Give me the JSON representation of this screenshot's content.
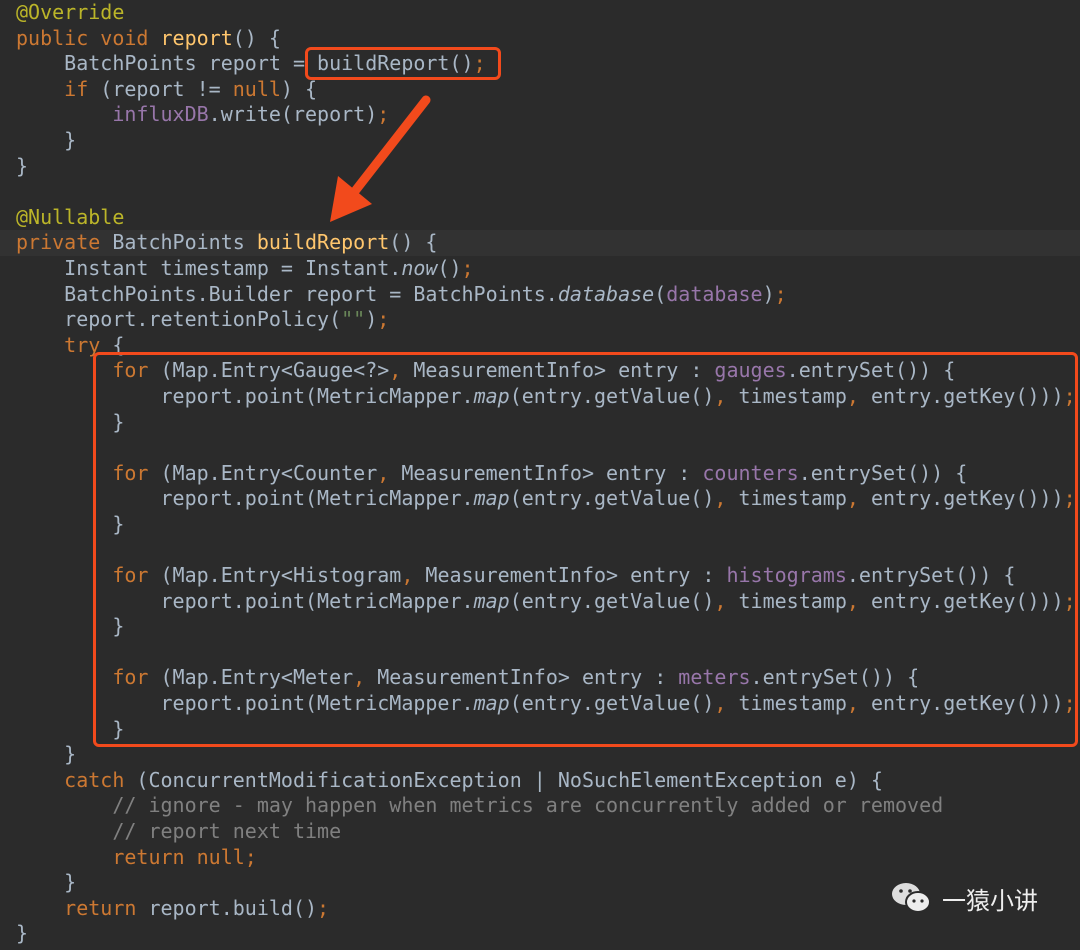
{
  "code_lines": [
    [
      [
        "@Override",
        "ann"
      ]
    ],
    [
      [
        "public void ",
        "kw"
      ],
      [
        "report",
        "decl"
      ],
      [
        "() {",
        ""
      ]
    ],
    [
      [
        "    BatchPoints report = buildReport()",
        ""
      ],
      [
        ";",
        "kw"
      ]
    ],
    [
      [
        "    if ",
        "kw"
      ],
      [
        "(report != ",
        ""
      ],
      [
        "null",
        "kw"
      ],
      [
        ") {",
        ""
      ]
    ],
    [
      [
        "        ",
        ""
      ],
      [
        "influxDB",
        "field"
      ],
      [
        ".write(report)",
        ""
      ],
      [
        ";",
        "kw"
      ]
    ],
    [
      [
        "    }",
        ""
      ]
    ],
    [
      [
        "}",
        ""
      ]
    ],
    [
      [
        "",
        ""
      ]
    ],
    [
      [
        "@Nullable",
        "ann"
      ]
    ],
    [
      [
        "private ",
        "kw"
      ],
      [
        "BatchPoints ",
        ""
      ],
      [
        "buildReport",
        "decl"
      ],
      [
        "() {",
        ""
      ]
    ],
    [
      [
        "    Instant timestamp = Instant.",
        ""
      ],
      [
        "now",
        "it"
      ],
      [
        "()",
        ""
      ],
      [
        ";",
        "kw"
      ]
    ],
    [
      [
        "    BatchPoints.Builder report = BatchPoints.",
        ""
      ],
      [
        "database",
        "it"
      ],
      [
        "(",
        ""
      ],
      [
        "database",
        "field"
      ],
      [
        ")",
        ""
      ],
      [
        ";",
        "kw"
      ]
    ],
    [
      [
        "    report.retentionPolicy(",
        ""
      ],
      [
        "\"\"",
        "str"
      ],
      [
        ")",
        ""
      ],
      [
        ";",
        "kw"
      ]
    ],
    [
      [
        "    try ",
        "kw"
      ],
      [
        "{",
        ""
      ]
    ],
    [
      [
        "        for ",
        "kw"
      ],
      [
        "(Map.Entry<Gauge<?>",
        ""
      ],
      [
        ", ",
        "kw"
      ],
      [
        "MeasurementInfo> entry : ",
        ""
      ],
      [
        "gauges",
        "field"
      ],
      [
        ".entrySet()) {",
        ""
      ]
    ],
    [
      [
        "            report.point(MetricMapper.",
        ""
      ],
      [
        "map",
        "it"
      ],
      [
        "(entry.getValue()",
        ""
      ],
      [
        ", ",
        "kw"
      ],
      [
        "timestamp",
        ""
      ],
      [
        ", ",
        "kw"
      ],
      [
        "entry.getKey()))",
        ""
      ],
      [
        ";",
        "kw"
      ]
    ],
    [
      [
        "        }",
        ""
      ]
    ],
    [
      [
        "",
        ""
      ]
    ],
    [
      [
        "        for ",
        "kw"
      ],
      [
        "(Map.Entry<Counter",
        ""
      ],
      [
        ", ",
        "kw"
      ],
      [
        "MeasurementInfo> entry : ",
        ""
      ],
      [
        "counters",
        "field"
      ],
      [
        ".entrySet()) {",
        ""
      ]
    ],
    [
      [
        "            report.point(MetricMapper.",
        ""
      ],
      [
        "map",
        "it"
      ],
      [
        "(entry.getValue()",
        ""
      ],
      [
        ", ",
        "kw"
      ],
      [
        "timestamp",
        ""
      ],
      [
        ", ",
        "kw"
      ],
      [
        "entry.getKey()))",
        ""
      ],
      [
        ";",
        "kw"
      ]
    ],
    [
      [
        "        }",
        ""
      ]
    ],
    [
      [
        "",
        ""
      ]
    ],
    [
      [
        "        for ",
        "kw"
      ],
      [
        "(Map.Entry<Histogram",
        ""
      ],
      [
        ", ",
        "kw"
      ],
      [
        "MeasurementInfo> entry : ",
        ""
      ],
      [
        "histograms",
        "field"
      ],
      [
        ".entrySet()) {",
        ""
      ]
    ],
    [
      [
        "            report.point(MetricMapper.",
        ""
      ],
      [
        "map",
        "it"
      ],
      [
        "(entry.getValue()",
        ""
      ],
      [
        ", ",
        "kw"
      ],
      [
        "timestamp",
        ""
      ],
      [
        ", ",
        "kw"
      ],
      [
        "entry.getKey()))",
        ""
      ],
      [
        ";",
        "kw"
      ]
    ],
    [
      [
        "        }",
        ""
      ]
    ],
    [
      [
        "",
        ""
      ]
    ],
    [
      [
        "        for ",
        "kw"
      ],
      [
        "(Map.Entry<Meter",
        ""
      ],
      [
        ", ",
        "kw"
      ],
      [
        "MeasurementInfo> entry : ",
        ""
      ],
      [
        "meters",
        "field"
      ],
      [
        ".entrySet()) {",
        ""
      ]
    ],
    [
      [
        "            report.point(MetricMapper.",
        ""
      ],
      [
        "map",
        "it"
      ],
      [
        "(entry.getValue()",
        ""
      ],
      [
        ", ",
        "kw"
      ],
      [
        "timestamp",
        ""
      ],
      [
        ", ",
        "kw"
      ],
      [
        "entry.getKey()))",
        ""
      ],
      [
        ";",
        "kw"
      ]
    ],
    [
      [
        "        }",
        ""
      ]
    ],
    [
      [
        "    }",
        ""
      ]
    ],
    [
      [
        "    catch ",
        "kw"
      ],
      [
        "(ConcurrentModificationException | NoSuchElementException e) {",
        ""
      ]
    ],
    [
      [
        "        // ignore - may happen when metrics are concurrently added or removed",
        "cmt"
      ]
    ],
    [
      [
        "        // report next time",
        "cmt"
      ]
    ],
    [
      [
        "        return null",
        "kw"
      ],
      [
        ";",
        "kw"
      ]
    ],
    [
      [
        "    }",
        ""
      ]
    ],
    [
      [
        "    return ",
        "kw"
      ],
      [
        "report.build()",
        ""
      ],
      [
        ";",
        "kw"
      ]
    ],
    [
      [
        "}",
        ""
      ]
    ]
  ],
  "current_line": 9,
  "watermark": {
    "text": "一猿小讲",
    "icon": "wechat-icon"
  },
  "highlight_color": "#f24a1c"
}
